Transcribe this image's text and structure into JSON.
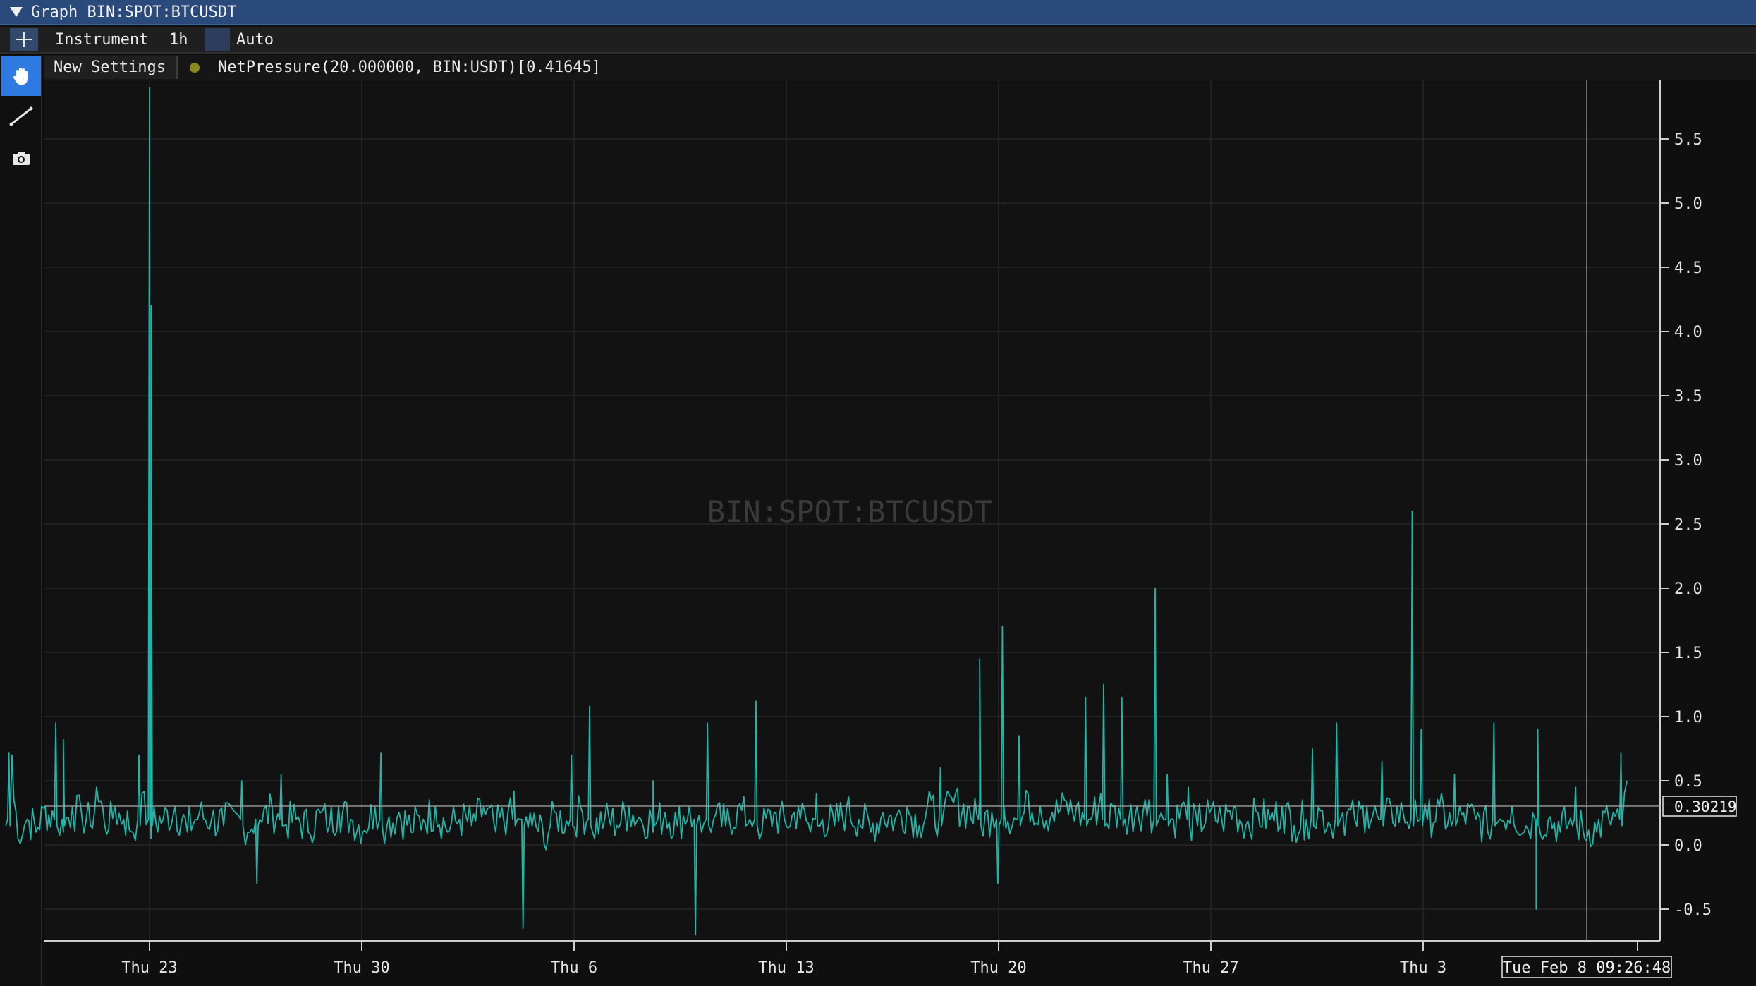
{
  "window": {
    "title": "Graph BIN:SPOT:BTCUSDT"
  },
  "toolbar": {
    "plus_icon": "plus-icon",
    "instrument_label": "Instrument",
    "interval_label": "1h",
    "auto_label": "Auto"
  },
  "subbar": {
    "new_settings_label": "New Settings",
    "indicator_label": "NetPressure(20.000000, BIN:USDT)[0.41645]",
    "indicator_dot_color": "#8c8a1c"
  },
  "sidebar": {
    "tools": [
      {
        "icon": "hand-icon",
        "active": true
      },
      {
        "icon": "line-tool-icon",
        "active": false
      },
      {
        "icon": "camera-icon",
        "active": false
      }
    ]
  },
  "chart_data": {
    "type": "line",
    "watermark": "BIN:SPOT:BTCUSDT",
    "ylim": [
      -0.75,
      5.95
    ],
    "yticks": [
      "-0.5",
      "0.0",
      "0.5",
      "1.0",
      "1.5",
      "2.0",
      "2.5",
      "3.0",
      "3.5",
      "4.0",
      "4.5",
      "5.0",
      "5.5"
    ],
    "xticks": [
      "Thu 23",
      "Thu 30",
      "Thu 6",
      "Thu 13",
      "Thu 20",
      "Thu 27",
      "Thu 3"
    ],
    "crosshair_value": "0.30219",
    "crosshair_time": "Tue Feb 8 09:26:48",
    "line_color": "#1fb5a8",
    "grid": true,
    "x_days_range": [
      0,
      53.6
    ],
    "series": [
      {
        "points": [
          [
            0.0,
            0.15
          ],
          [
            0.2,
            0.7
          ],
          [
            0.4,
            0.05
          ],
          [
            0.7,
            0.2
          ],
          [
            1.0,
            0.1
          ],
          [
            1.3,
            0.3
          ],
          [
            1.6,
            0.2
          ],
          [
            1.9,
            0.1
          ],
          [
            2.2,
            0.3
          ],
          [
            2.5,
            0.25
          ],
          [
            2.8,
            0.15
          ],
          [
            3.0,
            0.45
          ],
          [
            3.2,
            0.3
          ],
          [
            3.4,
            0.12
          ],
          [
            3.6,
            0.3
          ],
          [
            3.9,
            0.2
          ],
          [
            4.2,
            0.1
          ],
          [
            4.5,
            0.4
          ],
          [
            4.8,
            0.05
          ],
          [
            5.2,
            0.2
          ],
          [
            5.6,
            0.3
          ],
          [
            6.0,
            0.1
          ],
          [
            6.4,
            0.25
          ],
          [
            6.8,
            0.2
          ],
          [
            7.2,
            0.15
          ],
          [
            7.6,
            0.25
          ],
          [
            8.0,
            0.1
          ],
          [
            8.4,
            0.2
          ],
          [
            8.8,
            0.3
          ],
          [
            9.2,
            0.15
          ],
          [
            9.6,
            0.2
          ],
          [
            10.0,
            0.1
          ],
          [
            10.4,
            0.25
          ],
          [
            10.7,
            0.15
          ],
          [
            11.0,
            0.3
          ],
          [
            11.4,
            0.2
          ],
          [
            11.8,
            0.1
          ],
          [
            12.2,
            0.3
          ],
          [
            12.6,
            0.15
          ],
          [
            13.0,
            0.25
          ],
          [
            13.4,
            0.1
          ],
          [
            13.8,
            0.2
          ],
          [
            14.2,
            0.3
          ],
          [
            14.6,
            0.1
          ],
          [
            15.0,
            0.2
          ],
          [
            15.4,
            0.15
          ],
          [
            15.8,
            0.3
          ],
          [
            16.2,
            0.1
          ],
          [
            16.6,
            0.25
          ],
          [
            17.0,
            0.2
          ],
          [
            17.4,
            0.15
          ],
          [
            17.8,
            0.0
          ],
          [
            18.2,
            0.25
          ],
          [
            18.6,
            0.15
          ],
          [
            19.0,
            0.3
          ],
          [
            19.4,
            0.1
          ],
          [
            19.8,
            0.2
          ],
          [
            20.2,
            0.15
          ],
          [
            20.6,
            0.3
          ],
          [
            21.0,
            0.2
          ],
          [
            21.4,
            0.1
          ],
          [
            21.8,
            0.25
          ],
          [
            22.2,
            0.15
          ],
          [
            22.6,
            0.3
          ],
          [
            23.0,
            0.1
          ],
          [
            23.4,
            0.2
          ],
          [
            23.8,
            0.15
          ],
          [
            24.2,
            0.3
          ],
          [
            24.6,
            0.2
          ],
          [
            25.0,
            0.1
          ],
          [
            25.4,
            0.25
          ],
          [
            25.8,
            0.15
          ],
          [
            26.2,
            0.3
          ],
          [
            26.6,
            0.1
          ],
          [
            27.0,
            0.2
          ],
          [
            27.4,
            0.15
          ],
          [
            27.8,
            0.3
          ],
          [
            28.2,
            0.2
          ],
          [
            28.6,
            0.1
          ],
          [
            29.0,
            0.25
          ],
          [
            29.4,
            0.2
          ],
          [
            29.8,
            0.3
          ],
          [
            30.2,
            0.15
          ],
          [
            30.6,
            0.35
          ],
          [
            31.0,
            0.25
          ],
          [
            31.4,
            0.4
          ],
          [
            31.8,
            0.3
          ],
          [
            32.2,
            0.35
          ],
          [
            32.6,
            0.25
          ],
          [
            33.0,
            0.3
          ],
          [
            33.4,
            0.2
          ],
          [
            33.8,
            0.4
          ],
          [
            34.2,
            0.3
          ],
          [
            34.6,
            0.25
          ],
          [
            35.0,
            0.35
          ],
          [
            35.4,
            0.3
          ],
          [
            35.8,
            0.2
          ],
          [
            36.2,
            0.4
          ],
          [
            36.6,
            0.3
          ],
          [
            37.0,
            0.2
          ],
          [
            37.4,
            0.3
          ],
          [
            37.8,
            0.35
          ],
          [
            38.2,
            0.25
          ],
          [
            38.6,
            0.2
          ],
          [
            39.0,
            0.3
          ],
          [
            39.4,
            0.15
          ],
          [
            39.8,
            0.25
          ],
          [
            40.2,
            0.2
          ],
          [
            40.6,
            0.3
          ],
          [
            41.0,
            0.15
          ],
          [
            41.4,
            0.25
          ],
          [
            41.8,
            0.2
          ],
          [
            42.2,
            0.3
          ],
          [
            42.6,
            0.15
          ],
          [
            43.0,
            0.2
          ],
          [
            43.4,
            0.3
          ],
          [
            43.8,
            0.15
          ],
          [
            44.2,
            0.25
          ],
          [
            44.6,
            0.2
          ],
          [
            45.0,
            0.3
          ],
          [
            45.4,
            0.2
          ],
          [
            45.8,
            0.3
          ],
          [
            46.2,
            0.25
          ],
          [
            46.6,
            0.35
          ],
          [
            47.0,
            0.2
          ],
          [
            47.4,
            0.3
          ],
          [
            47.8,
            0.15
          ],
          [
            48.2,
            0.25
          ],
          [
            48.6,
            0.2
          ],
          [
            49.0,
            0.1
          ],
          [
            49.4,
            0.2
          ],
          [
            49.8,
            0.3
          ],
          [
            50.2,
            0.1
          ],
          [
            50.6,
            0.05
          ],
          [
            51.0,
            0.2
          ],
          [
            51.4,
            0.1
          ],
          [
            51.8,
            0.15
          ],
          [
            52.2,
            0.05
          ],
          [
            52.6,
            0.1
          ],
          [
            53.0,
            0.2
          ],
          [
            53.4,
            0.65
          ],
          [
            53.6,
            0.5
          ]
        ],
        "spikes": [
          [
            0.1,
            0.72
          ],
          [
            1.65,
            0.95
          ],
          [
            1.9,
            0.82
          ],
          [
            4.4,
            0.7
          ],
          [
            4.75,
            5.9
          ],
          [
            4.8,
            4.2
          ],
          [
            7.8,
            0.5
          ],
          [
            8.3,
            -0.3
          ],
          [
            9.1,
            0.55
          ],
          [
            12.4,
            0.72
          ],
          [
            16.8,
            0.42
          ],
          [
            17.1,
            -0.65
          ],
          [
            18.7,
            0.7
          ],
          [
            19.3,
            1.08
          ],
          [
            21.4,
            0.5
          ],
          [
            22.8,
            -0.7
          ],
          [
            23.2,
            0.95
          ],
          [
            24.8,
            1.12
          ],
          [
            26.8,
            0.4
          ],
          [
            30.9,
            0.6
          ],
          [
            32.2,
            1.45
          ],
          [
            32.8,
            -0.3
          ],
          [
            32.95,
            1.7
          ],
          [
            33.5,
            0.85
          ],
          [
            35.7,
            1.15
          ],
          [
            36.3,
            1.25
          ],
          [
            36.9,
            1.15
          ],
          [
            38.0,
            2.0
          ],
          [
            38.4,
            0.55
          ],
          [
            39.1,
            0.45
          ],
          [
            43.2,
            0.75
          ],
          [
            44.0,
            0.95
          ],
          [
            45.5,
            0.65
          ],
          [
            46.5,
            2.6
          ],
          [
            46.8,
            0.9
          ],
          [
            47.9,
            0.55
          ],
          [
            49.2,
            0.95
          ],
          [
            50.6,
            -0.5
          ],
          [
            50.65,
            0.9
          ],
          [
            51.9,
            0.45
          ],
          [
            53.4,
            0.72
          ]
        ]
      }
    ]
  }
}
